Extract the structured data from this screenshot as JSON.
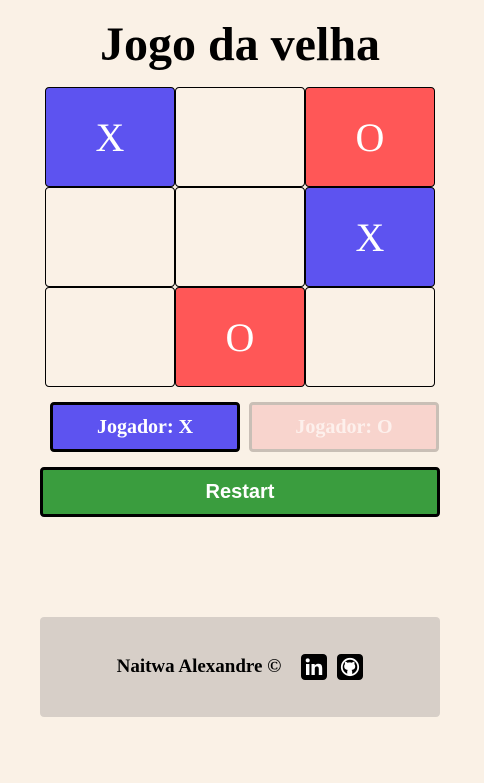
{
  "title": "Jogo da velha",
  "board": {
    "cells": [
      "X",
      "",
      "O",
      "",
      "",
      "X",
      "",
      "O",
      ""
    ]
  },
  "players": {
    "x_label": "Jogador: X",
    "o_label": "Jogador: O",
    "active": "X"
  },
  "restart_label": "Restart",
  "footer": {
    "text": "Naitwa Alexandre ©",
    "icons": [
      "linkedin-icon",
      "github-icon"
    ]
  },
  "colors": {
    "background": "#faf1e6",
    "x": "#5d53f0",
    "o": "#ff5757",
    "o_inactive": "#f8d4cd",
    "restart": "#3a9d3e",
    "footer": "#d7cfc8"
  }
}
